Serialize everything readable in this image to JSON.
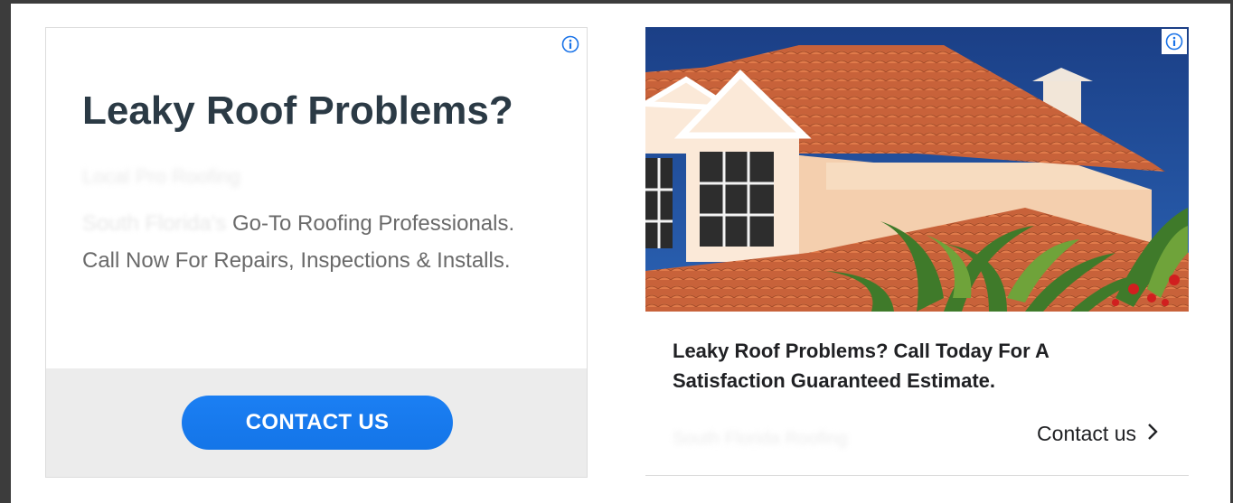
{
  "left_ad": {
    "headline": "Leaky Roof Problems?",
    "advertiser": "Local Pro Roofing",
    "body_faded": "South Florida's",
    "body_main": " Go-To Roofing Professionals. Call Now For Repairs, Inspections & Installs.",
    "cta_label": "CONTACT US",
    "info_icon": "info-icon"
  },
  "right_ad": {
    "headline": "Leaky Roof Problems? Call Today For A Satisfaction Guaranteed Estimate.",
    "advertiser": "South Florida Roofing",
    "cta_label": "Contact us",
    "info_icon": "info-icon",
    "chevron_icon": "chevron-right-icon"
  },
  "colors": {
    "cta_blue": "#1a73e8",
    "headline_dark": "#2b3a45",
    "body_gray": "#6a6a6a",
    "info_blue": "#1a73e8"
  }
}
